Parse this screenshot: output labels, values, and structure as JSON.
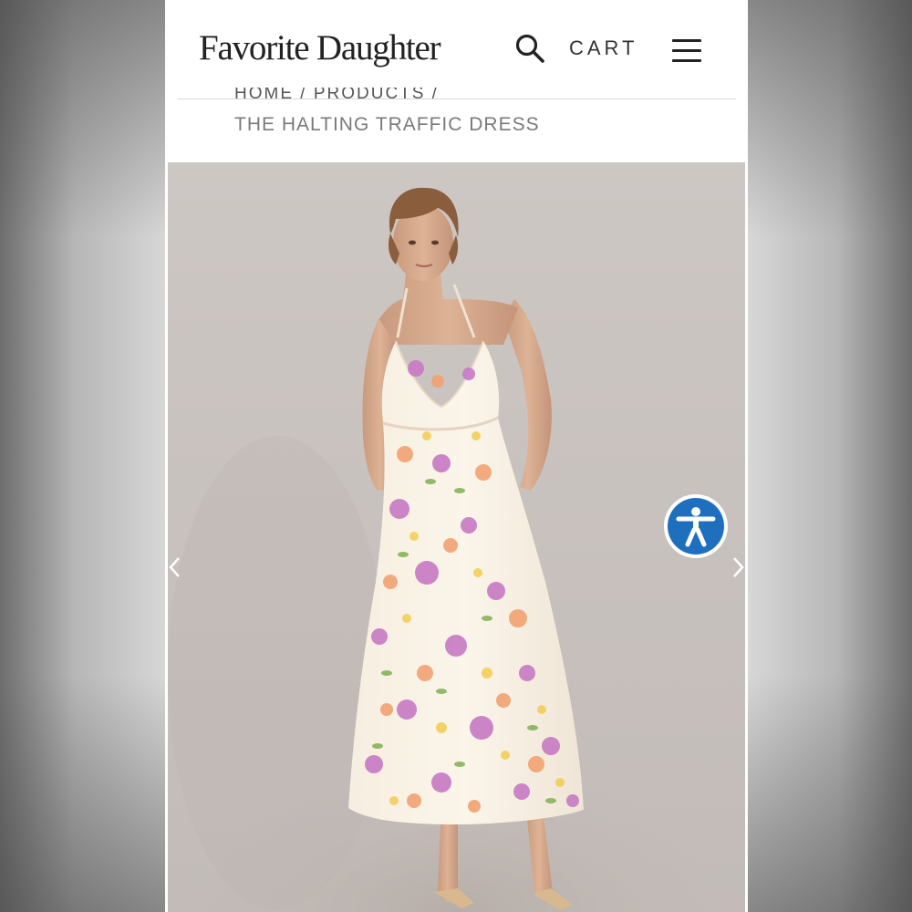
{
  "header": {
    "logo": "Favorite Daughter",
    "cart_label": "CART",
    "icons": {
      "search": "search-icon",
      "menu": "hamburger-menu-icon"
    }
  },
  "breadcrumb": {
    "path": "HOME / PRODUCTS /",
    "current": "THE HALTING TRAFFIC DRESS"
  },
  "gallery": {
    "icons": {
      "prev": "chevron-left-icon",
      "next": "chevron-right-icon",
      "accessibility": "accessibility-icon"
    }
  },
  "colors": {
    "background_panel": "#ffffff",
    "photo_backdrop": "#c9c3bf",
    "accessibility_blue": "#1f6fbf",
    "text_dark": "#222222",
    "text_muted": "#7a7a7a"
  }
}
